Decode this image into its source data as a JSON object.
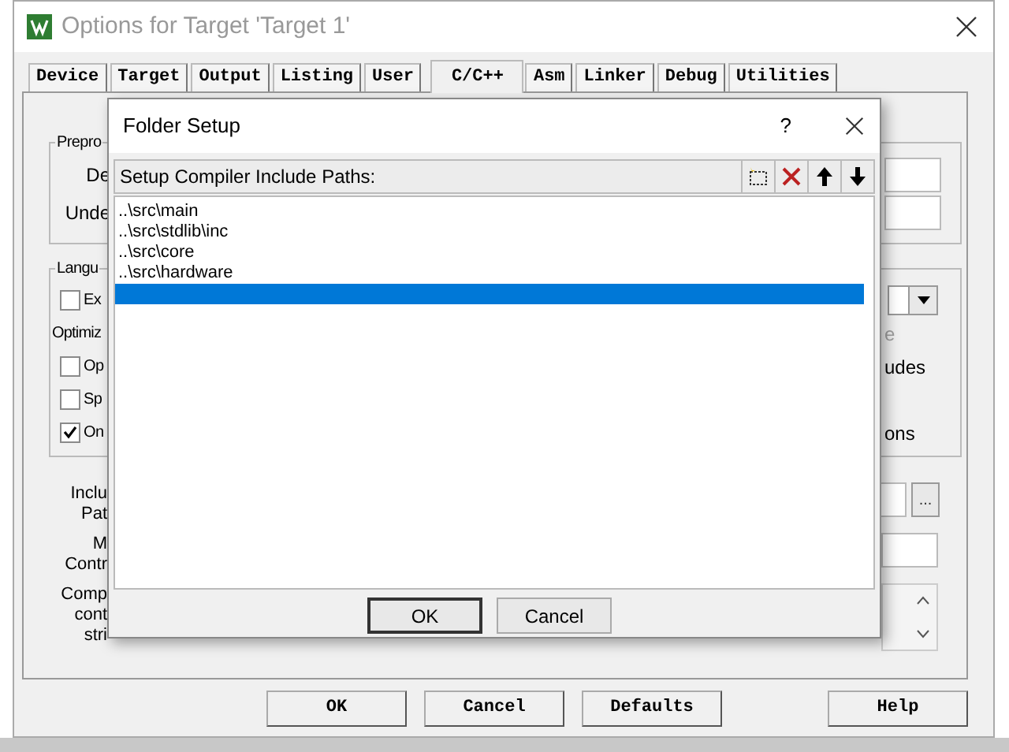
{
  "window": {
    "title": "Options for Target 'Target 1'"
  },
  "tabs": [
    {
      "label": "Device",
      "selected": false
    },
    {
      "label": "Target",
      "selected": false
    },
    {
      "label": "Output",
      "selected": false
    },
    {
      "label": "Listing",
      "selected": false
    },
    {
      "label": "User",
      "selected": false
    },
    {
      "label": "C/C++",
      "selected": true
    },
    {
      "label": "Asm",
      "selected": false
    },
    {
      "label": "Linker",
      "selected": false
    },
    {
      "label": "Debug",
      "selected": false
    },
    {
      "label": "Utilities",
      "selected": false
    }
  ],
  "preprocessor": {
    "group_label": "Prepro",
    "rows": [
      "De",
      "Unde"
    ]
  },
  "language": {
    "group_label": "Langu",
    "rows": [
      {
        "kind": "checkbox",
        "label": "Ex",
        "checked": false,
        "right": {
          "kind": "dropdown"
        }
      },
      {
        "kind": "label",
        "label": "Optimiz",
        "right": {
          "kind": "text",
          "text": "e",
          "disabled": true
        }
      },
      {
        "kind": "checkbox",
        "label": "Op",
        "checked": false,
        "right": {
          "kind": "text",
          "text": "udes",
          "disabled": false
        }
      },
      {
        "kind": "checkbox",
        "label": "Sp",
        "checked": false
      },
      {
        "kind": "checkbox",
        "label": "On",
        "checked": true,
        "right": {
          "kind": "text",
          "text": "ons",
          "disabled": false
        }
      }
    ]
  },
  "fields": [
    {
      "kind": "browse",
      "label_lines": [
        "Inclu",
        "Pat"
      ],
      "browse_label": "..."
    },
    {
      "kind": "text",
      "label_lines": [
        "M",
        "Contr"
      ]
    },
    {
      "kind": "textarea",
      "label_lines": [
        "Comp",
        "cont",
        "stri"
      ]
    }
  ],
  "buttons": [
    {
      "label": "OK",
      "kind": "main"
    },
    {
      "label": "Cancel",
      "kind": "main"
    },
    {
      "label": "Defaults",
      "kind": "main"
    },
    {
      "label": "Help",
      "kind": "help"
    }
  ],
  "folder_dialog": {
    "title": "Folder Setup",
    "help": "?",
    "caption": "Setup Compiler Include Paths:",
    "paths": [
      {
        "text": "..\\src\\main",
        "selected": false
      },
      {
        "text": "..\\src\\stdlib\\inc",
        "selected": false
      },
      {
        "text": "..\\src\\core",
        "selected": false
      },
      {
        "text": "..\\src\\hardware",
        "selected": false
      }
    ],
    "blank_row": {
      "selected": true
    },
    "buttons": [
      "OK",
      "Cancel"
    ]
  }
}
